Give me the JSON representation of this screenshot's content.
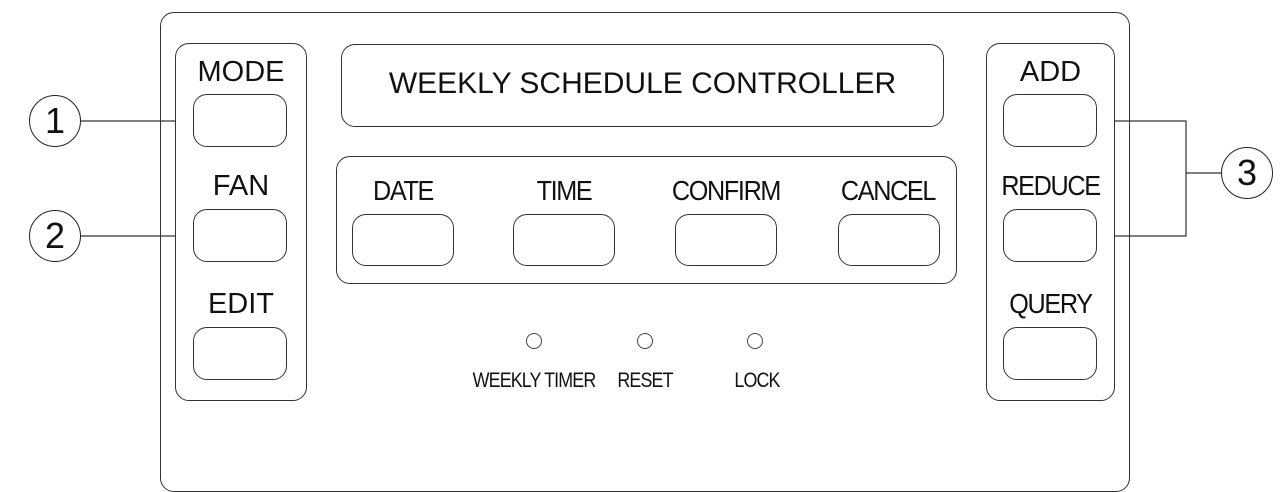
{
  "display": {
    "title": "WEEKLY SCHEDULE CONTROLLER"
  },
  "left_buttons": [
    {
      "label": "MODE"
    },
    {
      "label": "FAN"
    },
    {
      "label": "EDIT"
    }
  ],
  "center_buttons": [
    {
      "label": "DATE"
    },
    {
      "label": "TIME"
    },
    {
      "label": "CONFIRM"
    },
    {
      "label": "CANCEL"
    }
  ],
  "right_buttons": [
    {
      "label": "ADD"
    },
    {
      "label": "REDUCE"
    },
    {
      "label": "QUERY"
    }
  ],
  "indicators": [
    {
      "label": "WEEKLY TIMER"
    },
    {
      "label": "RESET"
    },
    {
      "label": "LOCK"
    }
  ],
  "callouts": [
    {
      "number": "1"
    },
    {
      "number": "2"
    },
    {
      "number": "3"
    }
  ]
}
